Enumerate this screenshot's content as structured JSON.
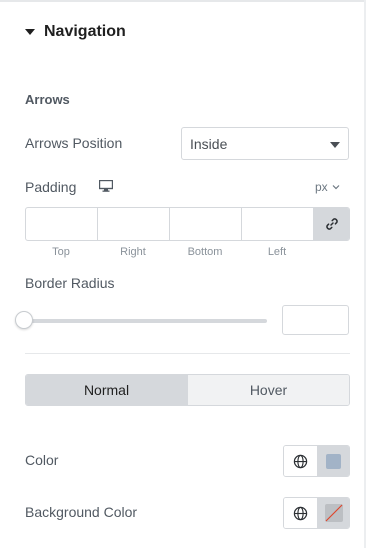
{
  "section": {
    "title": "Navigation"
  },
  "arrows": {
    "heading": "Arrows",
    "position_label": "Arrows Position",
    "position_value": "Inside",
    "padding_label": "Padding",
    "padding_unit": "px",
    "padding_fields": [
      "Top",
      "Right",
      "Bottom",
      "Left"
    ],
    "border_radius_label": "Border Radius"
  },
  "tabs": {
    "normal": "Normal",
    "hover": "Hover"
  },
  "colors": {
    "color_label": "Color",
    "bg_color_label": "Background Color",
    "color_swatch": "#a2b3c7",
    "bg_swatch": "#bcbfc3"
  },
  "icons": [
    "triangle-down-icon",
    "monitor-icon",
    "chevron-down-icon",
    "link-icon",
    "globe-icon"
  ]
}
